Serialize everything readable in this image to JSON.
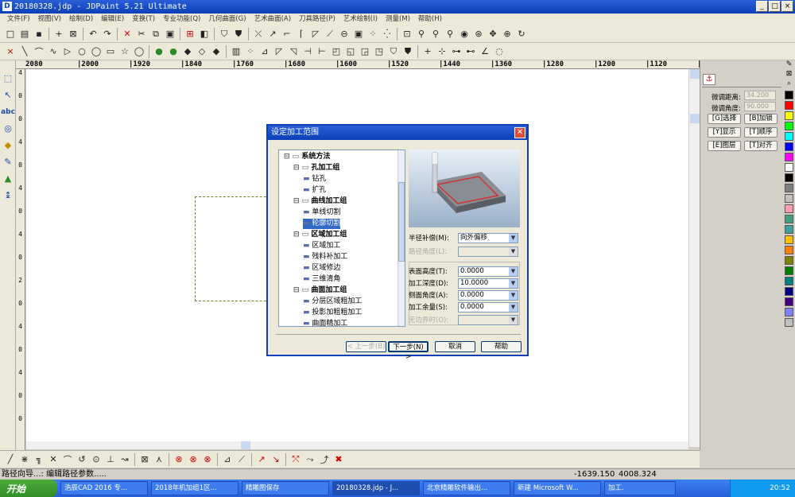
{
  "window": {
    "title": "20180328.jdp - JDPaint 5.21 Ultimate"
  },
  "menu": [
    "文件(F)",
    "视图(V)",
    "绘制(D)",
    "编辑(E)",
    "变换(T)",
    "专业功能(Q)",
    "几何曲面(G)",
    "艺术曲面(A)",
    "刀具路径(P)",
    "艺术绘制(I)",
    "测量(M)",
    "帮助(H)"
  ],
  "ruler_labels": [
    "2080",
    "2000",
    "1920",
    "1840",
    "1760",
    "1680",
    "1600",
    "1520",
    "1440",
    "1360",
    "1280",
    "1200",
    "1120",
    "mm"
  ],
  "vruler_text": [
    "4",
    "0",
    "0",
    "4",
    "0",
    "4",
    "0",
    "4",
    "0",
    "2",
    "0",
    "4",
    "0",
    "4",
    "0",
    "0"
  ],
  "dialog": {
    "title": "设定加工范围",
    "tree": [
      {
        "label": "系统方法",
        "level": 0,
        "group": true
      },
      {
        "label": "孔加工组",
        "level": 1,
        "group": true
      },
      {
        "label": "钻孔",
        "level": 2
      },
      {
        "label": "扩孔",
        "level": 2
      },
      {
        "label": "曲线加工组",
        "level": 1,
        "group": true
      },
      {
        "label": "单线切割",
        "level": 2
      },
      {
        "label": "轮廓切割",
        "level": 2,
        "selected": true
      },
      {
        "label": "区域加工组",
        "level": 1,
        "group": true
      },
      {
        "label": "区域加工",
        "level": 2
      },
      {
        "label": "残料补加工",
        "level": 2
      },
      {
        "label": "区域修边",
        "level": 2
      },
      {
        "label": "三维清角",
        "level": 2
      },
      {
        "label": "曲面加工组",
        "level": 1,
        "group": true
      },
      {
        "label": "分层区域粗加工",
        "level": 2
      },
      {
        "label": "投影加粗粗加工",
        "level": 2
      },
      {
        "label": "曲面精加工",
        "level": 2
      }
    ],
    "fields": {
      "radius_comp_label": "半径补偿(M):",
      "radius_comp_value": "向外偏移",
      "path_angle_label": "路径角度(L):",
      "surface_height_label": "表面高度(T):",
      "surface_height_value": "0.0000",
      "depth_label": "加工深度(D):",
      "depth_value": "10.0000",
      "side_angle_label": "侧面角度(A):",
      "side_angle_value": "0.0000",
      "allowance_label": "加工余量(S):",
      "allowance_value": "0.0000",
      "no_boundary_label": "无边界时(O):"
    },
    "buttons": {
      "back": "< 上一步(B)",
      "next": "下一步(N) >",
      "cancel": "取消",
      "help": "帮助"
    }
  },
  "right_panel": {
    "fine_distance_label": "微调距离:",
    "fine_distance_value": "34.200",
    "fine_angle_label": "微调角度:",
    "fine_angle_value": "90.000",
    "buttons": [
      "[G]选择",
      "[B]加锁",
      "[Y]显示",
      "[T]顺序",
      "[E]图层",
      "[T]对齐"
    ]
  },
  "palette": [
    "#000000",
    "#ff0000",
    "#ffff00",
    "#00ff00",
    "#00ffff",
    "#0000ff",
    "#ff00ff",
    "#ffffff",
    "#000000",
    "#808080",
    "#c0c0c0",
    "#ffa0b0",
    "#40a080",
    "#40a0a0",
    "#ffc000",
    "#ff8000",
    "#808000",
    "#008000",
    "#008080",
    "#000080",
    "#400080",
    "#8080ff",
    "#c0c0c0"
  ],
  "status": {
    "left": "路径向导...: 编辑路径参数.....",
    "coords_x": "-1639.150",
    "coords_y": "4008.324"
  },
  "taskbar": {
    "start": "开始",
    "tasks": [
      "浩辰CAD 2016 专...",
      "2018年机加组1区...",
      "精雕图保存",
      "20180328.jdp - J...",
      "北京精雕软件输出...",
      "新建 Microsoft W...",
      "加工."
    ],
    "clock": "20:52"
  }
}
